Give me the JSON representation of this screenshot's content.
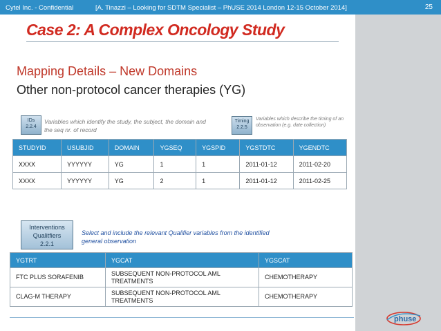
{
  "header": {
    "confidential": "Cytel Inc. - Confidential",
    "reference": "[A. Tinazzi – Looking for SDTM Specialist – PhUSE 2014 London 12-15 October 2014]",
    "slide_number": "25"
  },
  "title": "Case 2: A Complex Oncology Study",
  "subtitle": "Mapping Details – New Domains",
  "subtitle2": "Other non-protocol cancer therapies (YG)",
  "ids_chip": {
    "line1": "IDs",
    "line2": "2.2.4"
  },
  "ids_note": "Variables which identify the study, the subject, the domain and the seq nr. of record",
  "timing_chip": {
    "line1": "Timing",
    "line2": "2.2.5"
  },
  "timing_note": "Variables which describe the timing of an observation (e.g. date collection)",
  "table1": {
    "headers": [
      "STUDYID",
      "USUBJID",
      "DOMAIN",
      "YGSEQ",
      "YGSPID",
      "YGSTDTC",
      "YGENDTC"
    ],
    "rows": [
      [
        "XXXX",
        "YYYYYY",
        "YG",
        "1",
        "1",
        "2011-01-12",
        "2011-02-20"
      ],
      [
        "XXXX",
        "YYYYYY",
        "YG",
        "2",
        "1",
        "2011-01-12",
        "2011-02-25"
      ]
    ]
  },
  "interventions_chip": {
    "line1": "Interventions",
    "line2": "Qualitfiers",
    "line3": "2.2.1"
  },
  "qualifier_note": "Select and include the relevant Qualifier variables from the identified general observation",
  "table2": {
    "headers": [
      "YGTRT",
      "YGCAT",
      "YGSCAT"
    ],
    "rows": [
      [
        "FTC PLUS SORAFENIB",
        "SUBSEQUENT NON-PROTOCOL AML TREATMENTS",
        "CHEMOTHERAPY"
      ],
      [
        "CLAG-M THERAPY",
        "SUBSEQUENT NON-PROTOCOL AML TREATMENTS",
        "CHEMOTHERAPY"
      ]
    ]
  },
  "logo_text": "phuse",
  "colors": {
    "header_blue": "#2f8fc8",
    "title_red": "#d12a20",
    "sidebar_grey": "#d0d3d6"
  }
}
